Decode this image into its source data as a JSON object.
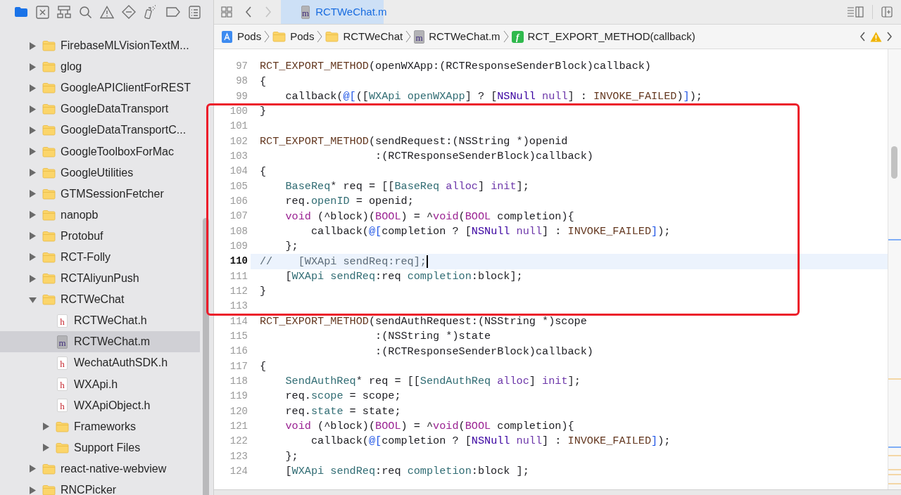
{
  "navigator": {
    "tree": [
      {
        "label": "FirebaseMLVisionTextM...",
        "kind": "folder",
        "expanded": false,
        "selected": false
      },
      {
        "label": "glog",
        "kind": "folder",
        "expanded": false,
        "selected": false
      },
      {
        "label": "GoogleAPIClientForREST",
        "kind": "folder",
        "expanded": false,
        "selected": false
      },
      {
        "label": "GoogleDataTransport",
        "kind": "folder",
        "expanded": false,
        "selected": false
      },
      {
        "label": "GoogleDataTransportC...",
        "kind": "folder",
        "expanded": false,
        "selected": false
      },
      {
        "label": "GoogleToolboxForMac",
        "kind": "folder",
        "expanded": false,
        "selected": false
      },
      {
        "label": "GoogleUtilities",
        "kind": "folder",
        "expanded": false,
        "selected": false
      },
      {
        "label": "GTMSessionFetcher",
        "kind": "folder",
        "expanded": false,
        "selected": false
      },
      {
        "label": "nanopb",
        "kind": "folder",
        "expanded": false,
        "selected": false
      },
      {
        "label": "Protobuf",
        "kind": "folder",
        "expanded": false,
        "selected": false
      },
      {
        "label": "RCT-Folly",
        "kind": "folder",
        "expanded": false,
        "selected": false
      },
      {
        "label": "RCTAliyunPush",
        "kind": "folder",
        "expanded": false,
        "selected": false
      },
      {
        "label": "RCTWeChat",
        "kind": "folder",
        "expanded": true,
        "selected": false,
        "children": [
          {
            "label": "RCTWeChat.h",
            "kind": "file",
            "icon_letter": "h",
            "selected": false
          },
          {
            "label": "RCTWeChat.m",
            "kind": "file",
            "icon_letter": "m",
            "selected": true
          },
          {
            "label": "WechatAuthSDK.h",
            "kind": "file",
            "icon_letter": "h",
            "selected": false
          },
          {
            "label": "WXApi.h",
            "kind": "file",
            "icon_letter": "h",
            "selected": false
          },
          {
            "label": "WXApiObject.h",
            "kind": "file",
            "icon_letter": "h",
            "selected": false
          },
          {
            "label": "Frameworks",
            "kind": "folder",
            "expanded": false,
            "selected": false
          },
          {
            "label": "Support Files",
            "kind": "folder",
            "expanded": false,
            "selected": false
          }
        ]
      },
      {
        "label": "react-native-webview",
        "kind": "folder",
        "expanded": false,
        "selected": false
      },
      {
        "label": "RNCPicker",
        "kind": "folder",
        "expanded": false,
        "selected": false
      }
    ]
  },
  "editor": {
    "forward_disabled": true,
    "tabs": [
      {
        "label": "RCTWeChat.m",
        "icon_letter": "m",
        "selected": true
      }
    ],
    "breadcrumbs": [
      {
        "label": "Pods",
        "kind": "project"
      },
      {
        "label": "Pods",
        "kind": "folder"
      },
      {
        "label": "RCTWeChat",
        "kind": "folder"
      },
      {
        "label": "RCTWeChat.m",
        "kind": "file",
        "icon_letter": "m"
      },
      {
        "label": "RCT_EXPORT_METHOD(callback)",
        "kind": "function",
        "icon_letter": "f"
      }
    ],
    "lines": [
      {
        "number": "97",
        "current": false,
        "tokens": [
          {
            "kind": "macro",
            "text": "RCT_EXPORT_METHOD"
          },
          {
            "kind": "plain",
            "text": "(openWXApp:(RCTResponseSenderBlock)callback)"
          }
        ]
      },
      {
        "number": "98",
        "current": false,
        "tokens": [
          {
            "kind": "plain",
            "text": "{"
          }
        ]
      },
      {
        "number": "99",
        "current": false,
        "tokens": [
          {
            "kind": "plain",
            "text": "    callback("
          },
          {
            "kind": "literal",
            "text": "@["
          },
          {
            "kind": "plain",
            "text": "(["
          },
          {
            "kind": "type",
            "text": "WXApi openWXApp"
          },
          {
            "kind": "plain",
            "text": "] ? ["
          },
          {
            "kind": "class",
            "text": "NSNull"
          },
          {
            "kind": "method",
            "text": " null"
          },
          {
            "kind": "plain",
            "text": "] : "
          },
          {
            "kind": "macro",
            "text": "INVOKE_FAILED"
          },
          {
            "kind": "plain",
            "text": ")"
          },
          {
            "kind": "literal",
            "text": "]"
          },
          {
            "kind": "plain",
            "text": ");"
          }
        ]
      },
      {
        "number": "100",
        "current": false,
        "tokens": [
          {
            "kind": "plain",
            "text": "}"
          }
        ]
      },
      {
        "number": "101",
        "current": false
      },
      {
        "number": "102",
        "current": false,
        "tokens": [
          {
            "kind": "macro",
            "text": "RCT_EXPORT_METHOD"
          },
          {
            "kind": "plain",
            "text": "(sendRequest:(NSString *)openid"
          }
        ]
      },
      {
        "number": "103",
        "current": false,
        "tokens": [
          {
            "kind": "plain",
            "text": "                  :(RCTResponseSenderBlock)callback)"
          }
        ]
      },
      {
        "number": "104",
        "current": false,
        "tokens": [
          {
            "kind": "plain",
            "text": "{"
          }
        ]
      },
      {
        "number": "105",
        "current": false,
        "tokens": [
          {
            "kind": "type",
            "text": "    BaseReq"
          },
          {
            "kind": "plain",
            "text": "* req = [["
          },
          {
            "kind": "type",
            "text": "BaseReq"
          },
          {
            "kind": "method",
            "text": " alloc"
          },
          {
            "kind": "plain",
            "text": "] "
          },
          {
            "kind": "method",
            "text": "init"
          },
          {
            "kind": "plain",
            "text": "];"
          }
        ]
      },
      {
        "number": "106",
        "current": false,
        "tokens": [
          {
            "kind": "plain",
            "text": "    req."
          },
          {
            "kind": "type",
            "text": "openID"
          },
          {
            "kind": "plain",
            "text": " = openid;"
          }
        ]
      },
      {
        "number": "107",
        "current": false,
        "tokens": [
          {
            "kind": "keyword",
            "text": "    void"
          },
          {
            "kind": "plain",
            "text": " (^block)("
          },
          {
            "kind": "keyword",
            "text": "BOOL"
          },
          {
            "kind": "plain",
            "text": ") = ^"
          },
          {
            "kind": "keyword",
            "text": "void"
          },
          {
            "kind": "plain",
            "text": "("
          },
          {
            "kind": "keyword",
            "text": "BOOL"
          },
          {
            "kind": "plain",
            "text": " completion){"
          }
        ]
      },
      {
        "number": "108",
        "current": false,
        "tokens": [
          {
            "kind": "plain",
            "text": "        callback("
          },
          {
            "kind": "literal",
            "text": "@["
          },
          {
            "kind": "plain",
            "text": "completion ? ["
          },
          {
            "kind": "class",
            "text": "NSNull"
          },
          {
            "kind": "method",
            "text": " null"
          },
          {
            "kind": "plain",
            "text": "] : "
          },
          {
            "kind": "macro",
            "text": "INVOKE_FAILED"
          },
          {
            "kind": "literal",
            "text": "]"
          },
          {
            "kind": "plain",
            "text": ");"
          }
        ]
      },
      {
        "number": "109",
        "current": false,
        "tokens": [
          {
            "kind": "plain",
            "text": "    };"
          }
        ]
      },
      {
        "number": "110",
        "current": true,
        "tokens": [
          {
            "kind": "comment",
            "text": "//    [WXApi sendReq:req];"
          }
        ]
      },
      {
        "number": "111",
        "current": false,
        "tokens": [
          {
            "kind": "plain",
            "text": "    ["
          },
          {
            "kind": "type",
            "text": "WXApi sendReq"
          },
          {
            "kind": "plain",
            "text": ":req "
          },
          {
            "kind": "type",
            "text": "completion"
          },
          {
            "kind": "plain",
            "text": ":block];"
          }
        ]
      },
      {
        "number": "112",
        "current": false,
        "tokens": [
          {
            "kind": "plain",
            "text": "}"
          }
        ]
      },
      {
        "number": "113",
        "current": false
      },
      {
        "number": "114",
        "current": false,
        "tokens": [
          {
            "kind": "macro",
            "text": "RCT_EXPORT_METHOD"
          },
          {
            "kind": "plain",
            "text": "(sendAuthRequest:(NSString *)scope"
          }
        ]
      },
      {
        "number": "115",
        "current": false,
        "tokens": [
          {
            "kind": "plain",
            "text": "                  :(NSString *)state"
          }
        ]
      },
      {
        "number": "116",
        "current": false,
        "tokens": [
          {
            "kind": "plain",
            "text": "                  :(RCTResponseSenderBlock)callback)"
          }
        ]
      },
      {
        "number": "117",
        "current": false,
        "tokens": [
          {
            "kind": "plain",
            "text": "{"
          }
        ]
      },
      {
        "number": "118",
        "current": false,
        "tokens": [
          {
            "kind": "type",
            "text": "    SendAuthReq"
          },
          {
            "kind": "plain",
            "text": "* req = [["
          },
          {
            "kind": "type",
            "text": "SendAuthReq"
          },
          {
            "kind": "method",
            "text": " alloc"
          },
          {
            "kind": "plain",
            "text": "] "
          },
          {
            "kind": "method",
            "text": "init"
          },
          {
            "kind": "plain",
            "text": "];"
          }
        ]
      },
      {
        "number": "119",
        "current": false,
        "tokens": [
          {
            "kind": "plain",
            "text": "    req."
          },
          {
            "kind": "type",
            "text": "scope"
          },
          {
            "kind": "plain",
            "text": " = scope;"
          }
        ]
      },
      {
        "number": "120",
        "current": false,
        "tokens": [
          {
            "kind": "plain",
            "text": "    req."
          },
          {
            "kind": "type",
            "text": "state"
          },
          {
            "kind": "plain",
            "text": " = state;"
          }
        ]
      },
      {
        "number": "121",
        "current": false,
        "tokens": [
          {
            "kind": "keyword",
            "text": "    void"
          },
          {
            "kind": "plain",
            "text": " (^block)("
          },
          {
            "kind": "keyword",
            "text": "BOOL"
          },
          {
            "kind": "plain",
            "text": ") = ^"
          },
          {
            "kind": "keyword",
            "text": "void"
          },
          {
            "kind": "plain",
            "text": "("
          },
          {
            "kind": "keyword",
            "text": "BOOL"
          },
          {
            "kind": "plain",
            "text": " completion){"
          }
        ]
      },
      {
        "number": "122",
        "current": false,
        "tokens": [
          {
            "kind": "plain",
            "text": "        callback("
          },
          {
            "kind": "literal",
            "text": "@["
          },
          {
            "kind": "plain",
            "text": "completion ? ["
          },
          {
            "kind": "class",
            "text": "NSNull"
          },
          {
            "kind": "method",
            "text": " null"
          },
          {
            "kind": "plain",
            "text": "] : "
          },
          {
            "kind": "macro",
            "text": "INVOKE_FAILED"
          },
          {
            "kind": "literal",
            "text": "]"
          },
          {
            "kind": "plain",
            "text": ");"
          }
        ]
      },
      {
        "number": "123",
        "current": false,
        "tokens": [
          {
            "kind": "plain",
            "text": "    };"
          }
        ]
      },
      {
        "number": "124",
        "current": false,
        "tokens": [
          {
            "kind": "plain",
            "text": "    ["
          },
          {
            "kind": "type",
            "text": "WXApi sendReq"
          },
          {
            "kind": "plain",
            "text": ":req "
          },
          {
            "kind": "type",
            "text": "completion"
          },
          {
            "kind": "plain",
            "text": ":block ];"
          }
        ]
      }
    ]
  }
}
